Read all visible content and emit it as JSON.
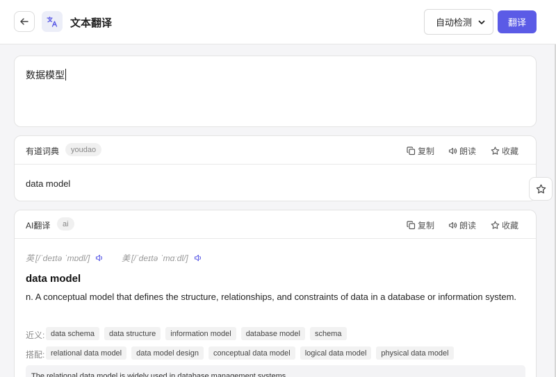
{
  "header": {
    "title": "文本翻译",
    "language_select": "自动检测",
    "translate_button": "翻译"
  },
  "input": {
    "text": "数据模型"
  },
  "actions": {
    "copy": "复制",
    "read": "朗读",
    "favorite": "收藏"
  },
  "youdao_card": {
    "title": "有道词典",
    "badge": "youdao",
    "result": "data model"
  },
  "ai_card": {
    "title": "AI翻译",
    "badge": "ai",
    "phonetic_uk_label": "英",
    "phonetic_uk": "[/ˈdeɪtə ˈmɒdl/]",
    "phonetic_us_label": "美",
    "phonetic_us": "[/ˈdeɪtə ˈmɑːdl/]",
    "word": "data model",
    "definition": "n. A conceptual model that defines the structure, relationships, and constraints of data in a database or information system.",
    "synonyms_label": "近义:",
    "synonyms": [
      "data schema",
      "data structure",
      "information model",
      "database model",
      "schema"
    ],
    "collocations_label": "搭配:",
    "collocations": [
      "relational data model",
      "data model design",
      "conceptual data model",
      "logical data model",
      "physical data model"
    ],
    "example": "The relational data model is widely used in database management systems."
  },
  "colors": {
    "accent": "#5b5be6",
    "card_bg": "#ffffff",
    "page_bg": "#f5f5f7"
  }
}
